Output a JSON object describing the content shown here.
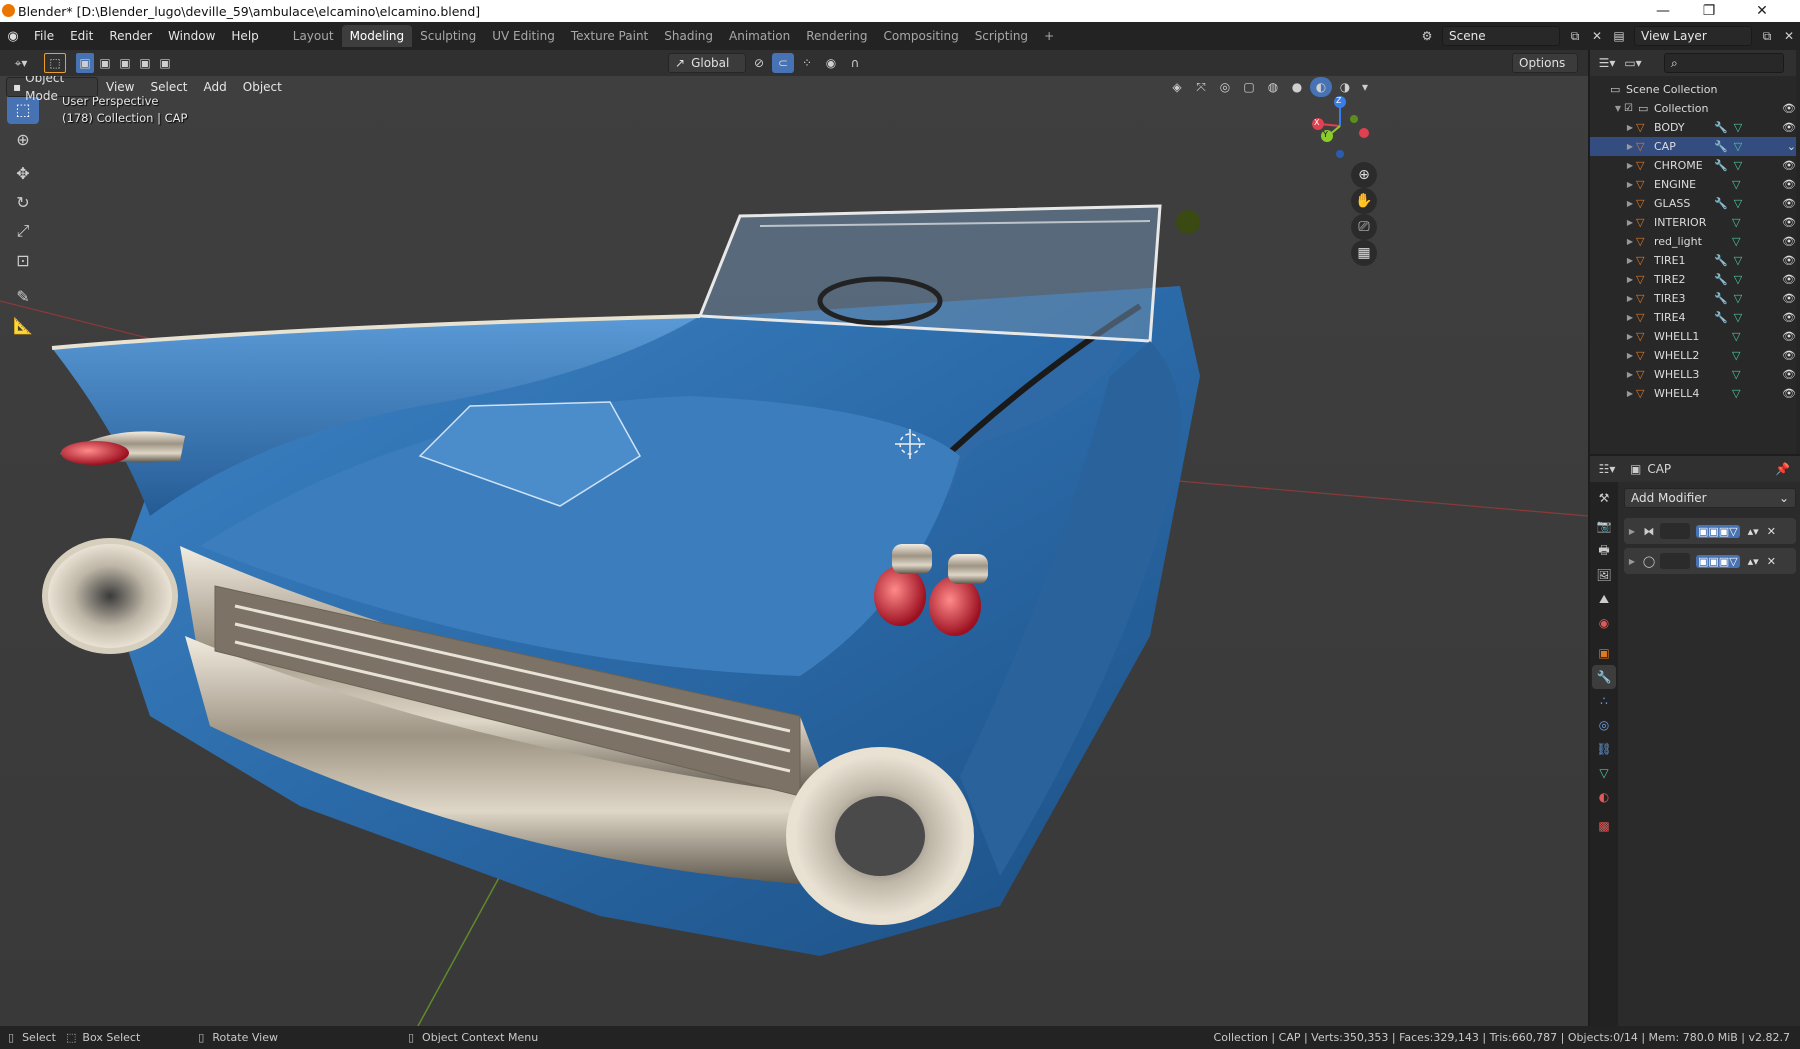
{
  "window": {
    "title": "Blender* [D:\\Blender_lugo\\deville_59\\ambulace\\elcamino\\elcamino.blend]",
    "min": "—",
    "max": "❐",
    "close": "✕"
  },
  "menu": [
    "File",
    "Edit",
    "Render",
    "Window",
    "Help"
  ],
  "workspaces": [
    {
      "label": "Layout",
      "active": false
    },
    {
      "label": "Modeling",
      "active": true
    },
    {
      "label": "Sculpting",
      "active": false
    },
    {
      "label": "UV Editing",
      "active": false
    },
    {
      "label": "Texture Paint",
      "active": false
    },
    {
      "label": "Shading",
      "active": false
    },
    {
      "label": "Animation",
      "active": false
    },
    {
      "label": "Rendering",
      "active": false
    },
    {
      "label": "Compositing",
      "active": false
    },
    {
      "label": "Scripting",
      "active": false
    }
  ],
  "add_workspace": "+",
  "scene": {
    "label": "Scene"
  },
  "view_layer": {
    "label": "View Layer"
  },
  "viewport_header": {
    "transform_orientation": "Global",
    "options": "Options",
    "mode": "Object Mode",
    "menus": [
      "View",
      "Select",
      "Add",
      "Object"
    ]
  },
  "viewport": {
    "perspective": "User Perspective",
    "collection_info": "(178) Collection | CAP",
    "gizmo": {
      "x": "X",
      "y": "Y",
      "z": "Z"
    }
  },
  "outliner": {
    "scene_collection": "Scene Collection",
    "collection": "Collection",
    "items": [
      {
        "name": "BODY",
        "modifier": true,
        "selected": false
      },
      {
        "name": "CAP",
        "modifier": true,
        "selected": true
      },
      {
        "name": "CHROME",
        "modifier": true,
        "selected": false
      },
      {
        "name": "ENGINE",
        "modifier": false,
        "selected": false
      },
      {
        "name": "GLASS",
        "modifier": true,
        "selected": false
      },
      {
        "name": "INTERIOR",
        "modifier": false,
        "selected": false
      },
      {
        "name": "red_light",
        "modifier": false,
        "selected": false
      },
      {
        "name": "TIRE1",
        "modifier": true,
        "selected": false
      },
      {
        "name": "TIRE2",
        "modifier": true,
        "selected": false
      },
      {
        "name": "TIRE3",
        "modifier": true,
        "selected": false
      },
      {
        "name": "TIRE4",
        "modifier": true,
        "selected": false
      },
      {
        "name": "WHELL1",
        "modifier": false,
        "selected": false
      },
      {
        "name": "WHELL2",
        "modifier": false,
        "selected": false
      },
      {
        "name": "WHELL3",
        "modifier": false,
        "selected": false
      },
      {
        "name": "WHELL4",
        "modifier": false,
        "selected": false
      }
    ]
  },
  "properties": {
    "object_name": "CAP",
    "add_modifier": "Add Modifier",
    "modifiers": 2
  },
  "statusbar": {
    "select": "Select",
    "box_select": "Box Select",
    "rotate_view": "Rotate View",
    "context_menu": "Object Context Menu",
    "stats": "Collection | CAP | Verts:350,353 | Faces:329,143 | Tris:660,787 | Objects:0/14 | Mem: 780.0 MiB | v2.82.7"
  },
  "colors": {
    "accent": "#4772b3",
    "mesh_icon": "#e07a22",
    "modifier_icon": "#6aa3e6",
    "vertex_data_icon": "#4ec9a2",
    "car_body": "#2b6aa8"
  }
}
